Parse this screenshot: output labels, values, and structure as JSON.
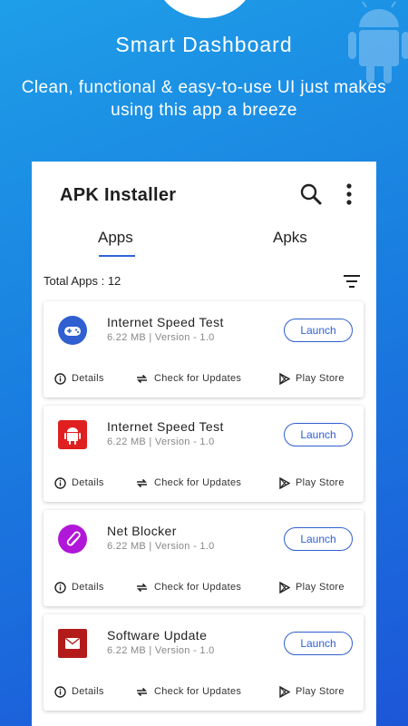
{
  "promo": {
    "headline": "Smart Dashboard",
    "subline": "Clean, functional & easy-to-use UI just makes using this app a breeze"
  },
  "appbar": {
    "title": "APK Installer",
    "search_icon": "search-icon",
    "more_icon": "more-vert-icon"
  },
  "tabs": [
    {
      "label": "Apps",
      "active": true
    },
    {
      "label": "Apks",
      "active": false
    }
  ],
  "list": {
    "total_label": "Total Apps : 12",
    "filter_icon": "filter-icon"
  },
  "apps": [
    {
      "name": "Internet Speed Test",
      "meta": "6.22 MB | Version - 1.0",
      "icon": "gamepad-icon",
      "icon_color": "#2f5fd0",
      "launch": "Launch",
      "details": "Details",
      "updates": "Check for Updates",
      "store": "Play Store"
    },
    {
      "name": "Internet Speed Test",
      "meta": "6.22 MB | Version - 1.0",
      "icon": "android-icon",
      "icon_color": "#e02020",
      "launch": "Launch",
      "details": "Details",
      "updates": "Check for Updates",
      "store": "Play Store"
    },
    {
      "name": "Net Blocker",
      "meta": "6.22 MB | Version - 1.0",
      "icon": "paperclip-icon",
      "icon_color": "#b117d8",
      "launch": "Launch",
      "details": "Details",
      "updates": "Check for Updates",
      "store": "Play Store"
    },
    {
      "name": "Software Update",
      "meta": "6.22 MB | Version - 1.0",
      "icon": "mail-icon",
      "icon_color": "#b31b1b",
      "launch": "Launch",
      "details": "Details",
      "updates": "Check for Updates",
      "store": "Play Store"
    }
  ],
  "colors": {
    "accent": "#2f5fd0",
    "background_top": "#1e9ee8",
    "background_bottom": "#1c56d8"
  }
}
